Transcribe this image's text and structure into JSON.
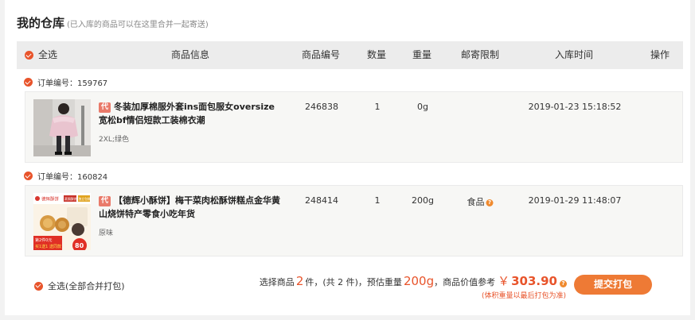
{
  "page": {
    "title": "我的仓库",
    "subtitle": "(已入库的商品可以在这里合并一起寄送)"
  },
  "table_header": {
    "select_all": "全选",
    "product_info": "商品信息",
    "product_code": "商品编号",
    "quantity": "数量",
    "weight": "重量",
    "shipping_limit": "邮寄限制",
    "stock_time": "入库时间",
    "action": "操作"
  },
  "orders": [
    {
      "order_label": "订单编号：159767",
      "tag": "代",
      "name": "冬装加厚棉服外套ins面包服女oversize宽松bf情侣短款工装棉衣潮",
      "spec": "2XL;绿色",
      "code": "246838",
      "quantity": "1",
      "weight": "0g",
      "shipping_limit": "",
      "stock_time": "2019-01-23 15:18:52"
    },
    {
      "order_label": "订单编号：160824",
      "tag": "代",
      "name": "【德辉小酥饼】梅干菜肉松酥饼糕点金华黄山烧饼特产零食小吃年货",
      "spec": "原味",
      "code": "248414",
      "quantity": "1",
      "weight": "200g",
      "shipping_limit": "食品",
      "stock_time": "2019-01-29 11:48:07",
      "image_text": {
        "brand": "德辉酥饼",
        "badge1": "蒸锅酥饼",
        "badge2": "独立包装",
        "promo_top": "第2件0元",
        "promo_bottom": "买1送1 送同款",
        "promo_price": "80"
      }
    }
  ],
  "footer": {
    "select_all_merge": "全选(全部合并打包)",
    "summary_prefix": "选择商品",
    "selected_count": "2",
    "unit_pieces": "件，",
    "total_text": "(共 2 件)，预估重量",
    "estimated_weight": "200g",
    "value_text": "，商品价值参考",
    "currency": "￥",
    "total_value": "303.90",
    "weight_note": "(体积重量以最后打包为准)",
    "submit_label": "提交打包"
  },
  "colors": {
    "accent": "#e8542b",
    "button": "#ee7a35",
    "header_bg": "#ececec",
    "row_bg": "#f7f7f5"
  }
}
